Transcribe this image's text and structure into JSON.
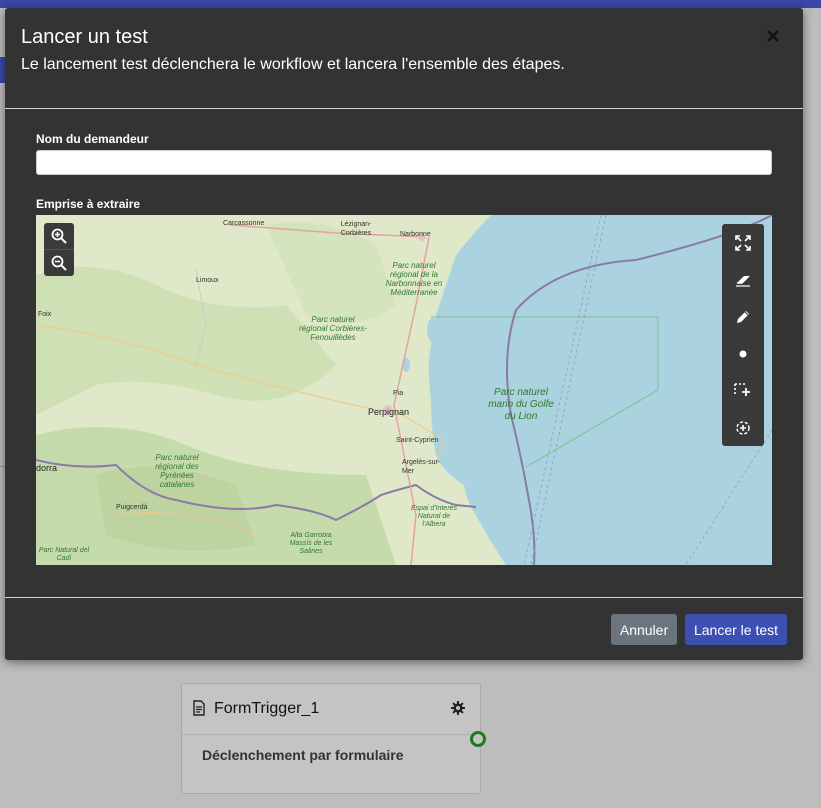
{
  "modal": {
    "title": "Lancer un test",
    "subtitle": "Le lancement test déclenchera le workflow et lancera l'ensemble des étapes.",
    "requester_label": "Nom du demandeur",
    "requester_value": "",
    "area_label": "Emprise à extraire",
    "cancel_label": "Annuler",
    "launch_label": "Lancer le test"
  },
  "map": {
    "cities": [
      "Carcassonne",
      "Lézignan-Corbières",
      "Narbonne",
      "Limoux",
      "Foix",
      "Perpignan",
      "Pia",
      "Saint-Cyprien",
      "Argelès-sur-Mer",
      "Puigcerdà",
      "dorra"
    ],
    "parks": [
      "Parc naturel régional de la Narbonnaise en Méditerranée",
      "Parc naturel régional Corbières-Fenouillèdes",
      "Parc naturel régional des Pyrénées catalanes",
      "Espai d'Interès Natural de l'Albera",
      "Alta Garrotxa Massís de les Salines",
      "Parc Natural del Cadí"
    ],
    "marine_park": "Parc naturel marin du Golfe du Lion",
    "zoom_controls": [
      "zoom-in-icon",
      "zoom-out-icon"
    ],
    "tools": [
      "fullscreen-icon",
      "eraser-icon",
      "pencil-icon",
      "point-icon",
      "select-area-icon",
      "locate-icon"
    ],
    "colors": {
      "sea": "#aad3df",
      "land": "#dfe9c9",
      "forest": "#c8dcae",
      "border": "#8a7aa8",
      "road": "#e8a0a0"
    }
  },
  "node": {
    "title": "FormTrigger_1",
    "description": "Déclenchement par formulaire",
    "port_color": "#1f7a1f"
  },
  "theme": {
    "accent": "#3d4fb3",
    "modal_bg": "#333333",
    "cancel_bg": "#6c757d"
  }
}
